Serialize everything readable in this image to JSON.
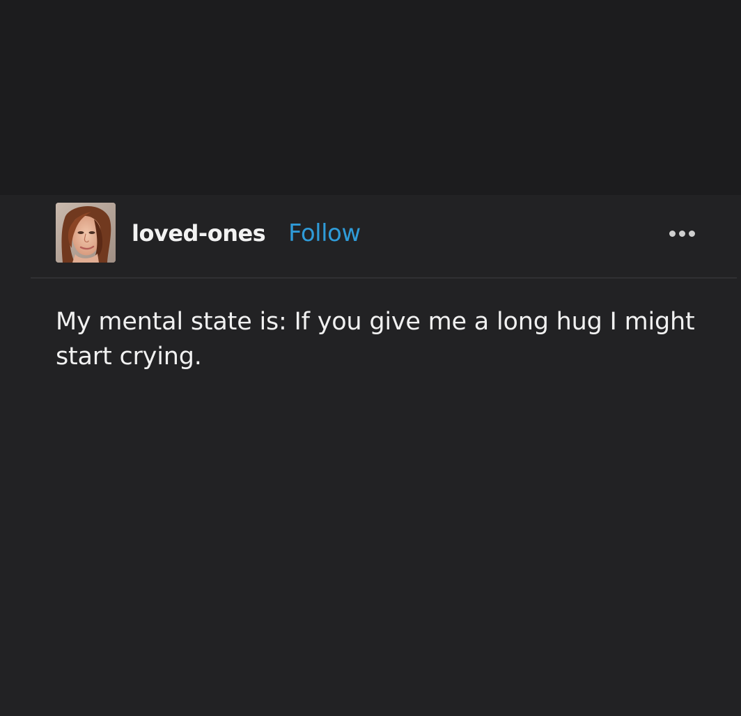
{
  "post": {
    "username": "loved-ones",
    "follow_label": "Follow",
    "text": "My mental state is: If you give me a long hug I might start crying."
  },
  "icons": {
    "avatar": "profile-photo",
    "more": "more-options-icon"
  },
  "colors": {
    "background": "#1c1c1e",
    "post_background": "#222224",
    "accent": "#2f9bd8",
    "text": "#f1f1f1"
  }
}
